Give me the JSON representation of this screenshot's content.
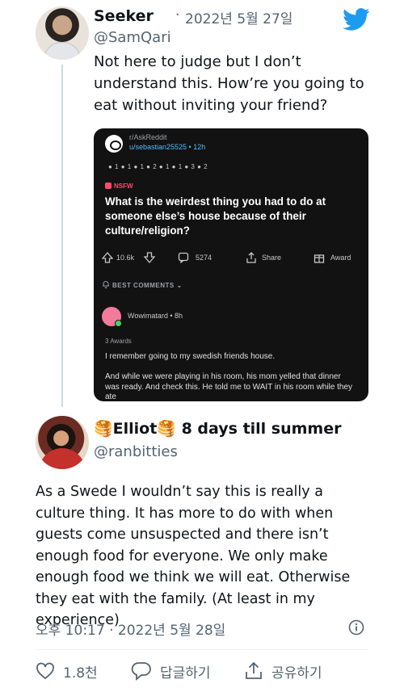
{
  "tweet1": {
    "display_name": "Seeker",
    "separator": "·",
    "date": "2022년 5월 27일",
    "handle": "@SamQari",
    "text": "Not here to judge but I don’t understand this. How’re you going to eat without inviting your friend?"
  },
  "embedded": {
    "subreddit": "r/AskReddit",
    "user_meta": "u/sebastian25525 • 12h",
    "awards": "● 1  ● 1  ● 1  ● 2  ● 1  ● 1  ● 3  ● 2",
    "nsfw": "NSFW",
    "title": "What is the weirdest thing you had to do at someone else’s house because of their culture/religion?",
    "votes": "10.6k",
    "comments": "5274",
    "share": "Share",
    "award": "Award",
    "best_comments": "BEST COMMENTS",
    "comment_user": "Wowimatard • 8h",
    "comment_awards": "3 Awards",
    "comment_line1": "I remember going to my swedish friends house.",
    "comment_line2": "And while we were playing in his room, his mom yelled that dinner was ready. And check this. He told me to WAIT in his room while they ate"
  },
  "tweet2": {
    "display_name": "🥞Elliot🥞 8 days till summer",
    "handle": "@ranbitties",
    "text": "As a Swede I wouldn’t say this is really a culture thing. It has more to do with when guests come unsuspected and there isn’t enough food for everyone. We only make enough food we think we will eat. Otherwise they eat with the family. (At least in my experience)",
    "timestamp": "오후 10:17 · 2022년 5월 28일",
    "likes": "1.8천",
    "reply_label": "답글하기",
    "share_label": "공유하기"
  },
  "colors": {
    "twitter_blue": "#1d9bf0",
    "secondary_text": "#536471",
    "card_bg": "#121212",
    "nsfw_red": "#ff4a6e"
  },
  "icons": [
    "twitter-bird-icon",
    "info-icon",
    "heart-icon",
    "reply-icon",
    "share-icon",
    "upvote-icon",
    "downvote-icon",
    "comment-icon",
    "bell-icon"
  ]
}
